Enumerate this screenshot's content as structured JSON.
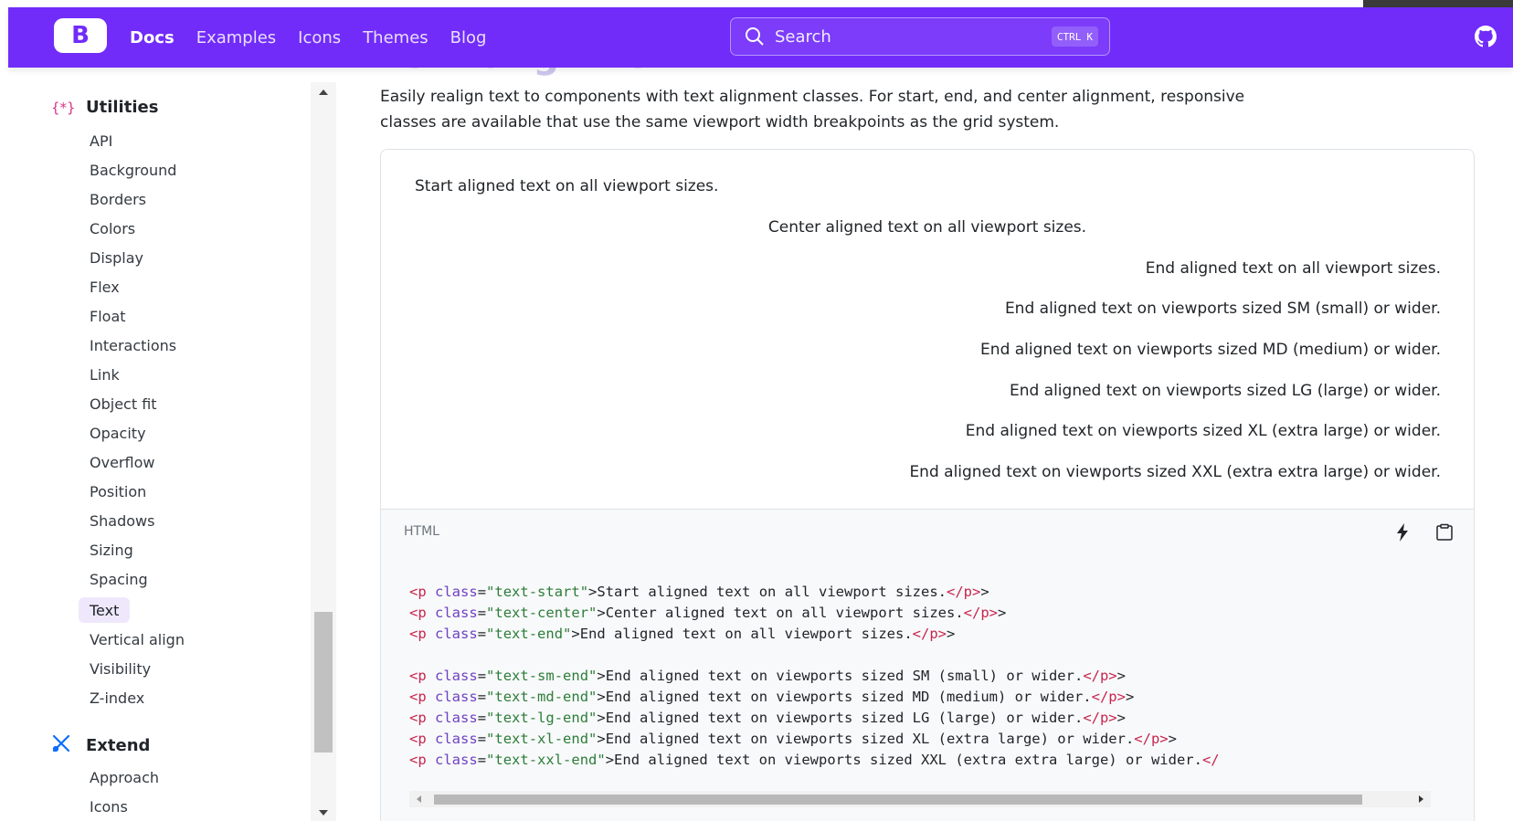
{
  "nav": {
    "brand": "B",
    "links": [
      "Docs",
      "Examples",
      "Icons",
      "Themes",
      "Blog"
    ],
    "active_link": "Docs",
    "search_placeholder": "Search",
    "search_shortcut_ctrl": "CTRL",
    "search_shortcut_key": "K"
  },
  "page": {
    "title": "Text alignment",
    "intro_line1": "Easily realign text to components with text alignment classes. For start, end, and center alignment, responsive",
    "intro_line2": "classes are available that use the same viewport width breakpoints as the grid system."
  },
  "sidebar": {
    "utilities_heading": "Utilities",
    "utilities_icon": "{*}",
    "utilities_items": [
      "API",
      "Background",
      "Borders",
      "Colors",
      "Display",
      "Flex",
      "Float",
      "Interactions",
      "Link",
      "Object fit",
      "Opacity",
      "Overflow",
      "Position",
      "Shadows",
      "Sizing",
      "Spacing",
      "Text",
      "Vertical align",
      "Visibility",
      "Z-index"
    ],
    "active_item": "Text",
    "extend_heading": "Extend",
    "extend_items": [
      "Approach",
      "Icons"
    ]
  },
  "example": {
    "lines": [
      "Start aligned text on all viewport sizes.",
      "Center aligned text on all viewport sizes.",
      "End aligned text on all viewport sizes.",
      "End aligned text on viewports sized SM (small) or wider.",
      "End aligned text on viewports sized MD (medium) or wider.",
      "End aligned text on viewports sized LG (large) or wider.",
      "End aligned text on viewports sized XL (extra large) or wider.",
      "End aligned text on viewports sized XXL (extra extra large) or wider."
    ]
  },
  "code": {
    "language": "HTML",
    "lines": [
      {
        "cls": "text-start",
        "text": "Start aligned text on all viewport sizes.",
        "close": "</p>"
      },
      {
        "cls": "text-center",
        "text": "Center aligned text on all viewport sizes.",
        "close": "</p>"
      },
      {
        "cls": "text-end",
        "text": "End aligned text on all viewport sizes.",
        "close": "</p>"
      },
      {
        "cls": "text-sm-end",
        "text": "End aligned text on viewports sized SM (small) or wider.",
        "close": "</p>"
      },
      {
        "cls": "text-md-end",
        "text": "End aligned text on viewports sized MD (medium) or wider.",
        "close": "</p>"
      },
      {
        "cls": "text-lg-end",
        "text": "End aligned text on viewports sized LG (large) or wider.",
        "close": "</p>"
      },
      {
        "cls": "text-xl-end",
        "text": "End aligned text on viewports sized XL (extra large) or wider.",
        "close": "</p>"
      },
      {
        "cls": "text-xxl-end",
        "text": "End aligned text on viewports sized XXL (extra extra large) or wider.",
        "close": "</"
      }
    ]
  },
  "colors": {
    "brand": "#712cf9",
    "active_bg": "#efe8fd"
  }
}
